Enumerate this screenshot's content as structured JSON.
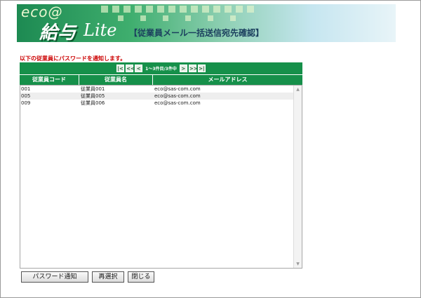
{
  "header": {
    "logo_eco": "eco@",
    "logo_kyuyo": "給与",
    "logo_lite": "Lite",
    "title": "【従業員メール一括送信宛先確認】"
  },
  "notice": "以下の従業員にパスワードを通知します。",
  "pager": {
    "first": "|<",
    "prev_block": "<<",
    "prev": "<",
    "info": "1〜3件目/3件中",
    "next": ">",
    "next_block": ">>",
    "last": ">|"
  },
  "table": {
    "headers": [
      "従業員コード",
      "従業員名",
      "メールアドレス"
    ],
    "rows": [
      {
        "code": "001",
        "name": "従業員001",
        "email": "eco@sas-com.com"
      },
      {
        "code": "005",
        "name": "従業員005",
        "email": "eco@sas-com.com"
      },
      {
        "code": "009",
        "name": "従業員006",
        "email": "eco@sas-com.com"
      }
    ]
  },
  "buttons": {
    "notify": "パスワード通知",
    "reselect": "再選択",
    "close": "閉じる"
  },
  "colors": {
    "header_green": "#16904a",
    "notice_red": "#cc0000"
  }
}
